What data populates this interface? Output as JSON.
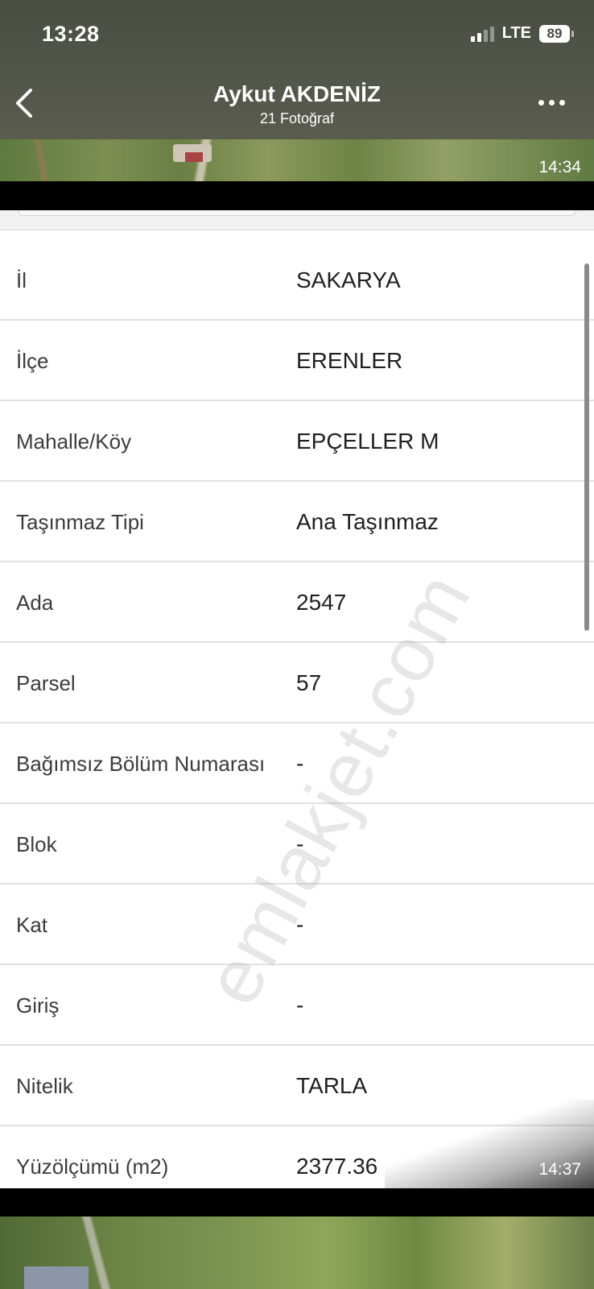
{
  "status_bar": {
    "time": "13:28",
    "network": "LTE",
    "battery": "89"
  },
  "header": {
    "title": "Aykut AKDENİZ",
    "subtitle": "21 Fotoğraf",
    "back_icon": "chevron-left-icon",
    "more_icon": "ellipsis-icon"
  },
  "photos": {
    "top_timestamp": "14:34",
    "bottom_timestamp": "14:37"
  },
  "watermark": "emlakjet.com",
  "details": [
    {
      "label": "İl",
      "value": "SAKARYA"
    },
    {
      "label": "İlçe",
      "value": "ERENLER"
    },
    {
      "label": "Mahalle/Köy",
      "value": "EPÇELLER M"
    },
    {
      "label": "Taşınmaz Tipi",
      "value": "Ana Taşınmaz"
    },
    {
      "label": "Ada",
      "value": "2547"
    },
    {
      "label": "Parsel",
      "value": "57"
    },
    {
      "label": "Bağımsız Bölüm Numarası",
      "value": "-"
    },
    {
      "label": "Blok",
      "value": "-"
    },
    {
      "label": "Kat",
      "value": "-"
    },
    {
      "label": "Giriş",
      "value": "-"
    },
    {
      "label": "Nitelik",
      "value": "TARLA"
    },
    {
      "label": "Yüzölçümü (m2)",
      "value": "2377.36"
    }
  ]
}
